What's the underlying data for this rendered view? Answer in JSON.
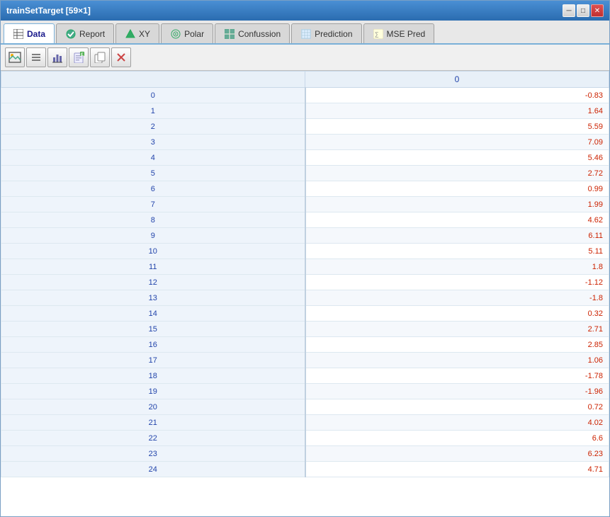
{
  "window": {
    "title": "trainSetTarget [59×1]",
    "minimize_label": "─",
    "maximize_label": "□",
    "close_label": "✕"
  },
  "tabs": [
    {
      "id": "data",
      "label": "Data",
      "icon": "table-icon",
      "active": true
    },
    {
      "id": "report",
      "label": "Report",
      "icon": "check-icon",
      "active": false
    },
    {
      "id": "xy",
      "label": "XY",
      "icon": "xy-icon",
      "active": false
    },
    {
      "id": "polar",
      "label": "Polar",
      "icon": "polar-icon",
      "active": false
    },
    {
      "id": "confussion",
      "label": "Confussion",
      "icon": "confusion-icon",
      "active": false
    },
    {
      "id": "prediction",
      "label": "Prediction",
      "icon": "prediction-icon",
      "active": false
    },
    {
      "id": "mse-pred",
      "label": "MSE Pred",
      "icon": "mse-icon",
      "active": false
    }
  ],
  "toolbar": {
    "buttons": [
      {
        "id": "image-btn",
        "icon": "🖼",
        "label": "image"
      },
      {
        "id": "list-btn",
        "icon": "≡",
        "label": "list"
      },
      {
        "id": "bar-btn",
        "icon": "▐",
        "label": "bar"
      },
      {
        "id": "export-btn",
        "icon": "📋",
        "label": "export"
      },
      {
        "id": "copy-btn",
        "icon": "📄",
        "label": "copy"
      },
      {
        "id": "delete-btn",
        "icon": "✕",
        "label": "delete"
      }
    ]
  },
  "table": {
    "column_header": "0",
    "rows": [
      {
        "index": 0,
        "value": "-0.83"
      },
      {
        "index": 1,
        "value": "1.64"
      },
      {
        "index": 2,
        "value": "5.59"
      },
      {
        "index": 3,
        "value": "7.09"
      },
      {
        "index": 4,
        "value": "5.46"
      },
      {
        "index": 5,
        "value": "2.72"
      },
      {
        "index": 6,
        "value": "0.99"
      },
      {
        "index": 7,
        "value": "1.99"
      },
      {
        "index": 8,
        "value": "4.62"
      },
      {
        "index": 9,
        "value": "6.11"
      },
      {
        "index": 10,
        "value": "5.11"
      },
      {
        "index": 11,
        "value": "1.8"
      },
      {
        "index": 12,
        "value": "-1.12"
      },
      {
        "index": 13,
        "value": "-1.8"
      },
      {
        "index": 14,
        "value": "0.32"
      },
      {
        "index": 15,
        "value": "2.71"
      },
      {
        "index": 16,
        "value": "2.85"
      },
      {
        "index": 17,
        "value": "1.06"
      },
      {
        "index": 18,
        "value": "-1.78"
      },
      {
        "index": 19,
        "value": "-1.96"
      },
      {
        "index": 20,
        "value": "0.72"
      },
      {
        "index": 21,
        "value": "4.02"
      },
      {
        "index": 22,
        "value": "6.6"
      },
      {
        "index": 23,
        "value": "6.23"
      },
      {
        "index": 24,
        "value": "4.71"
      }
    ]
  }
}
